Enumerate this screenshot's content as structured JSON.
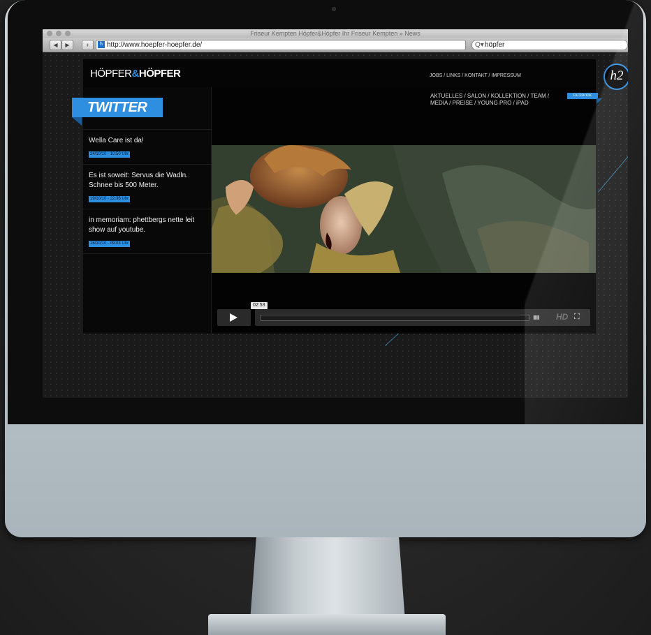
{
  "browser": {
    "title": "Friseur Kempten Höpfer&Höpfer Ihr Friseur Kempten » News",
    "url": "http://www.hoepfer-hoepfer.de/",
    "search_value": "höpfer",
    "back_icon": "◀",
    "forward_icon": "▶",
    "add_icon": "+",
    "reload_icon": "C",
    "search_prefix": "Q▾"
  },
  "site": {
    "logo_first": "HÖPFER",
    "logo_amp": "&",
    "logo_second": "HÖPFER",
    "top_nav": "JOBS / LINKS / KONTAKT / IMPRESSUM",
    "badge": "h2",
    "main_nav": "AKTUELLES / SALON / KOLLEKTION / TEAM / MEDIA / PREISE / YOUNG PRO / iPAD",
    "facebook_label": "FACEBOOK",
    "twitter_title": "TWITTER",
    "tweets": [
      {
        "text": "Wella Care ist da!",
        "date": "24/10/10 - 10:50 Uhr"
      },
      {
        "text": "Es ist soweit: Servus die Wadln. Schnee bis 500 Meter.",
        "date": "19/10/10 - 22:36 Uhr"
      },
      {
        "text": "in memoriam: phettbergs nette leit show auf youtube.",
        "date": "16/10/10 - 09:03 Uhr"
      }
    ]
  },
  "player": {
    "time": "02:53",
    "hd_label": "HD",
    "volume_icon": "IIIIIII",
    "fullscreen_icon": "⛶",
    "accent": "#2e8ee0"
  }
}
